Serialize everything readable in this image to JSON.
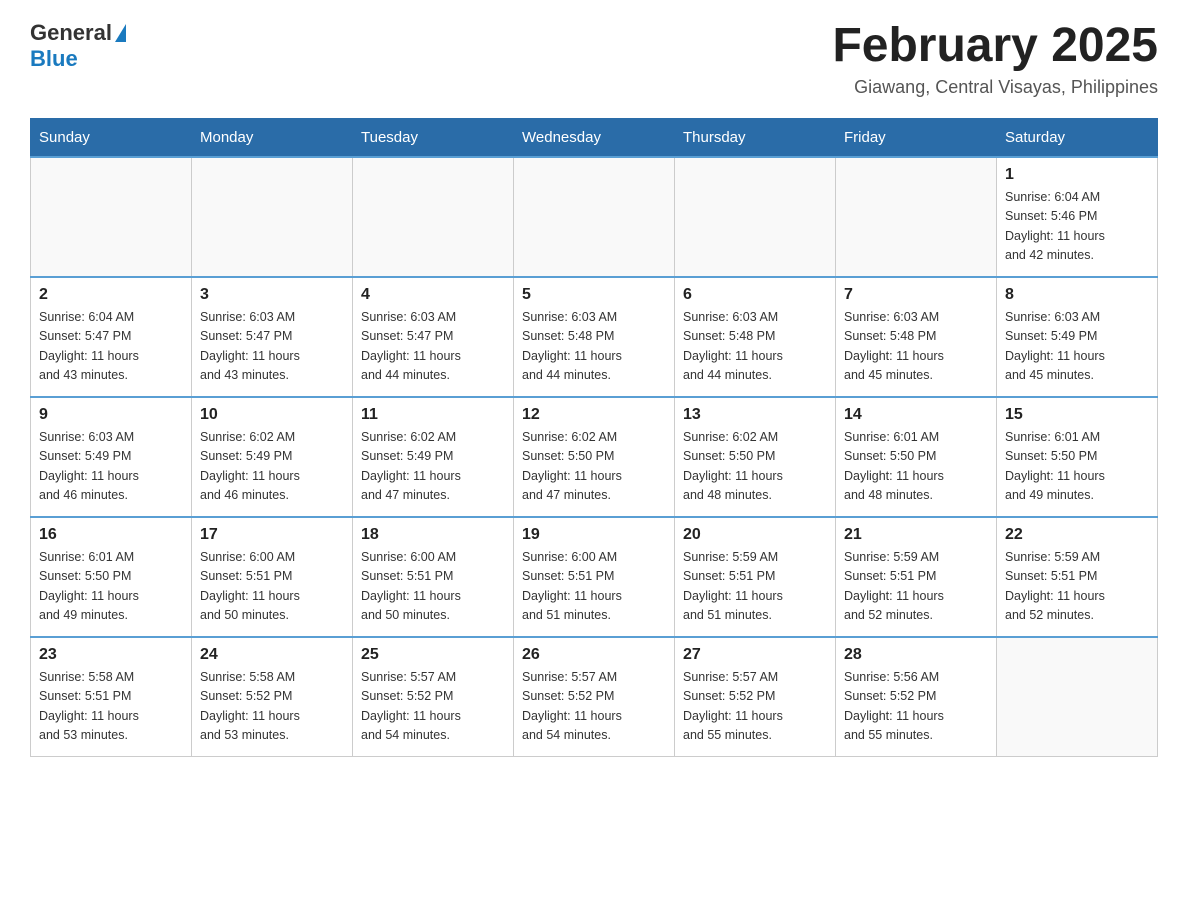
{
  "header": {
    "logo": {
      "general": "General",
      "blue": "Blue"
    },
    "title": "February 2025",
    "location": "Giawang, Central Visayas, Philippines"
  },
  "weekdays": [
    "Sunday",
    "Monday",
    "Tuesday",
    "Wednesday",
    "Thursday",
    "Friday",
    "Saturday"
  ],
  "weeks": [
    [
      {
        "day": "",
        "info": ""
      },
      {
        "day": "",
        "info": ""
      },
      {
        "day": "",
        "info": ""
      },
      {
        "day": "",
        "info": ""
      },
      {
        "day": "",
        "info": ""
      },
      {
        "day": "",
        "info": ""
      },
      {
        "day": "1",
        "info": "Sunrise: 6:04 AM\nSunset: 5:46 PM\nDaylight: 11 hours\nand 42 minutes."
      }
    ],
    [
      {
        "day": "2",
        "info": "Sunrise: 6:04 AM\nSunset: 5:47 PM\nDaylight: 11 hours\nand 43 minutes."
      },
      {
        "day": "3",
        "info": "Sunrise: 6:03 AM\nSunset: 5:47 PM\nDaylight: 11 hours\nand 43 minutes."
      },
      {
        "day": "4",
        "info": "Sunrise: 6:03 AM\nSunset: 5:47 PM\nDaylight: 11 hours\nand 44 minutes."
      },
      {
        "day": "5",
        "info": "Sunrise: 6:03 AM\nSunset: 5:48 PM\nDaylight: 11 hours\nand 44 minutes."
      },
      {
        "day": "6",
        "info": "Sunrise: 6:03 AM\nSunset: 5:48 PM\nDaylight: 11 hours\nand 44 minutes."
      },
      {
        "day": "7",
        "info": "Sunrise: 6:03 AM\nSunset: 5:48 PM\nDaylight: 11 hours\nand 45 minutes."
      },
      {
        "day": "8",
        "info": "Sunrise: 6:03 AM\nSunset: 5:49 PM\nDaylight: 11 hours\nand 45 minutes."
      }
    ],
    [
      {
        "day": "9",
        "info": "Sunrise: 6:03 AM\nSunset: 5:49 PM\nDaylight: 11 hours\nand 46 minutes."
      },
      {
        "day": "10",
        "info": "Sunrise: 6:02 AM\nSunset: 5:49 PM\nDaylight: 11 hours\nand 46 minutes."
      },
      {
        "day": "11",
        "info": "Sunrise: 6:02 AM\nSunset: 5:49 PM\nDaylight: 11 hours\nand 47 minutes."
      },
      {
        "day": "12",
        "info": "Sunrise: 6:02 AM\nSunset: 5:50 PM\nDaylight: 11 hours\nand 47 minutes."
      },
      {
        "day": "13",
        "info": "Sunrise: 6:02 AM\nSunset: 5:50 PM\nDaylight: 11 hours\nand 48 minutes."
      },
      {
        "day": "14",
        "info": "Sunrise: 6:01 AM\nSunset: 5:50 PM\nDaylight: 11 hours\nand 48 minutes."
      },
      {
        "day": "15",
        "info": "Sunrise: 6:01 AM\nSunset: 5:50 PM\nDaylight: 11 hours\nand 49 minutes."
      }
    ],
    [
      {
        "day": "16",
        "info": "Sunrise: 6:01 AM\nSunset: 5:50 PM\nDaylight: 11 hours\nand 49 minutes."
      },
      {
        "day": "17",
        "info": "Sunrise: 6:00 AM\nSunset: 5:51 PM\nDaylight: 11 hours\nand 50 minutes."
      },
      {
        "day": "18",
        "info": "Sunrise: 6:00 AM\nSunset: 5:51 PM\nDaylight: 11 hours\nand 50 minutes."
      },
      {
        "day": "19",
        "info": "Sunrise: 6:00 AM\nSunset: 5:51 PM\nDaylight: 11 hours\nand 51 minutes."
      },
      {
        "day": "20",
        "info": "Sunrise: 5:59 AM\nSunset: 5:51 PM\nDaylight: 11 hours\nand 51 minutes."
      },
      {
        "day": "21",
        "info": "Sunrise: 5:59 AM\nSunset: 5:51 PM\nDaylight: 11 hours\nand 52 minutes."
      },
      {
        "day": "22",
        "info": "Sunrise: 5:59 AM\nSunset: 5:51 PM\nDaylight: 11 hours\nand 52 minutes."
      }
    ],
    [
      {
        "day": "23",
        "info": "Sunrise: 5:58 AM\nSunset: 5:51 PM\nDaylight: 11 hours\nand 53 minutes."
      },
      {
        "day": "24",
        "info": "Sunrise: 5:58 AM\nSunset: 5:52 PM\nDaylight: 11 hours\nand 53 minutes."
      },
      {
        "day": "25",
        "info": "Sunrise: 5:57 AM\nSunset: 5:52 PM\nDaylight: 11 hours\nand 54 minutes."
      },
      {
        "day": "26",
        "info": "Sunrise: 5:57 AM\nSunset: 5:52 PM\nDaylight: 11 hours\nand 54 minutes."
      },
      {
        "day": "27",
        "info": "Sunrise: 5:57 AM\nSunset: 5:52 PM\nDaylight: 11 hours\nand 55 minutes."
      },
      {
        "day": "28",
        "info": "Sunrise: 5:56 AM\nSunset: 5:52 PM\nDaylight: 11 hours\nand 55 minutes."
      },
      {
        "day": "",
        "info": ""
      }
    ]
  ]
}
